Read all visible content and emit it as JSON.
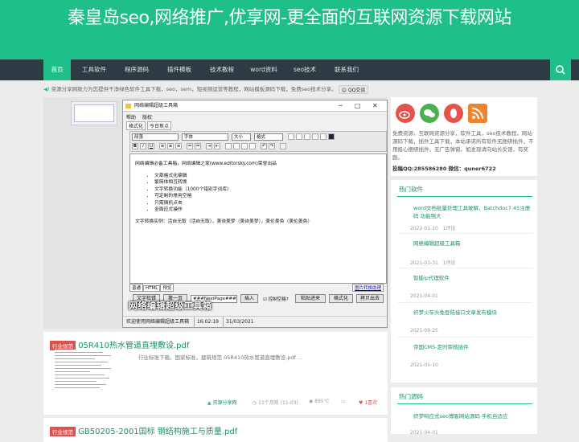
{
  "site": {
    "title": "秦皇岛seo,网络推广,优享网-更全面的互联网资源下载网站"
  },
  "nav": {
    "items": [
      "首页",
      "工具软件",
      "程序源码",
      "插件模板",
      "技术教程",
      "word资料",
      "seo技术",
      "联系我们"
    ]
  },
  "notice": {
    "text": "资源分享网致力为您提供干净绿色软件工具下载，seo，sem，短视频运营等教程，网站模板源码下载，免费seo技术分享。",
    "qq_label": "QQ交谈"
  },
  "screenshot_window": {
    "title": "网络编辑超级工具箱",
    "menu": [
      "帮助",
      "版权"
    ],
    "tabs": [
      "格式化",
      "今日焦点"
    ],
    "selects": [
      "段落",
      "字体",
      "大小",
      "格式"
    ],
    "format_buttons": [
      "B",
      "I",
      "U"
    ],
    "editor_heading": "网络编辑必备工具箱，网络编辑之家(www.editorsky.com)荣誉出品",
    "editor_list": [
      "文章格式化编辑",
      "繁简体相互转换",
      "文字转换功能（1000个错别字词库）",
      "可定制的常用空格",
      "只需随机点击",
      "全面应式操作"
    ],
    "editor_footer": "文字转换实例：活自无取（活自无取），美诙美梦（美诙美梦），美伦美奂（美伦美奂）",
    "mode_tabs": [
      "普通",
      "HTML",
      "预览"
    ],
    "mode_link": "图片转换助理",
    "bottom_buttons": [
      "文字检错",
      "第一页",
      "插入",
      "粘贴进来",
      "格式化",
      "拷贝出去"
    ],
    "page_field": "###NextPage###",
    "checkbox_label": "控制空格?",
    "status": [
      "欢迎使用网络编辑超级工具箱",
      "16:02:19",
      "31/03/2021"
    ],
    "overlay": "网络编辑超级工具箱"
  },
  "posts": [
    {
      "badge": "行业规范",
      "title": "05R410热水管道直埋敷设.pdf",
      "excerpt": "行业标准下载，国家标准，建筑规范 05R410热水管道直埋敷设.pdf ...",
      "author": "资源分享网",
      "date": "11个月前 (11-03)",
      "views": "895℃",
      "likes": "1喜欢"
    },
    {
      "badge": "行业规范",
      "title": "GB50205-2001国标 钢结构施工与质量.pdf"
    }
  ],
  "sidebar": {
    "about": "免费资源，互联网资源分享，软件工具，seo技术教程，网站源码下载，插件工具下载，本站承诺所有软件无捆绑插件，不用担心捆绑插件，无广告弹窗。如发现请向站长反馈，有奖励。",
    "contact": "投稿QQ:285586280 微信：quner6722",
    "hot_software_title": "热门软件",
    "hot_software": [
      {
        "title": "word文档批量处理工具破解，Batchdoc7.45注册码 功能强大",
        "date": "2022-01-10",
        "comments": "1评论"
      },
      {
        "title": "网络编辑超级工具箱",
        "date": "2021-03-31",
        "comments": "1评论"
      },
      {
        "title": "智能ip代理软件",
        "date": "2021-04-01",
        "comments": ""
      },
      {
        "title": "织梦火车头免登陆接口文章发布模块",
        "date": "2021-09-25",
        "comments": ""
      },
      {
        "title": "帝国CMS-定时审核插件",
        "date": "2021-05-10",
        "comments": ""
      }
    ],
    "hot_source_title": "热门源码",
    "hot_source": [
      {
        "title": "织梦响应式seo博客网站源码 手机自适应",
        "date": "2021-04-01"
      }
    ]
  },
  "colors": {
    "brand": "#1fbf8a",
    "nav": "#2f3b43",
    "badge": "#d9534f"
  },
  "icons": {
    "search": "search-icon",
    "weibo": "weibo-icon",
    "wechat": "wechat-icon",
    "qq": "qq-icon",
    "rss": "rss-icon"
  }
}
